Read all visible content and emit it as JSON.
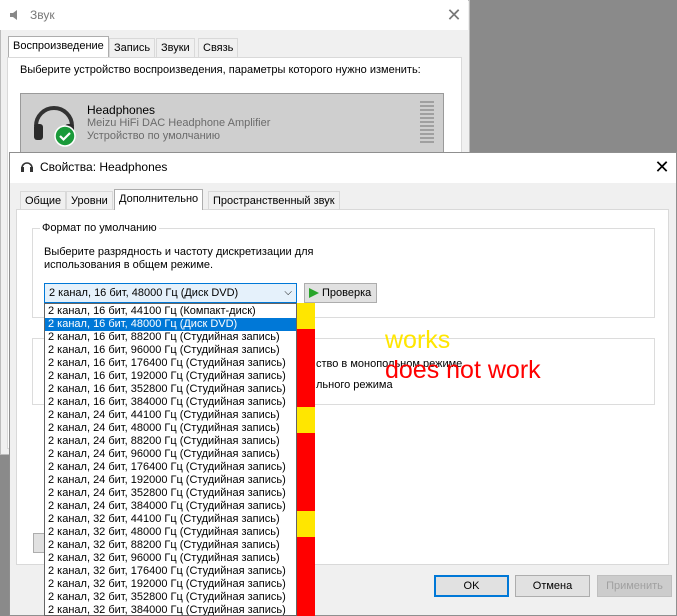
{
  "sound_window": {
    "title": "Звук",
    "tabs": [
      "Воспроизведение",
      "Запись",
      "Звуки",
      "Связь"
    ],
    "active_tab": 0,
    "description": "Выберите устройство воспроизведения, параметры которого нужно изменить:",
    "device": {
      "name": "Headphones",
      "description": "Meizu HiFi DAC Headphone Amplifier",
      "status": "Устройство по умолчанию"
    }
  },
  "props_window": {
    "title": "Свойства: Headphones",
    "tabs": [
      "Общие",
      "Уровни",
      "Дополнительно",
      "Пространственный звук"
    ],
    "active_tab": 2,
    "default_format": {
      "legend": "Формат по умолчанию",
      "description": "Выберите разрядность и частоту дискретизации для использования в общем режиме.",
      "selected": "2 канал, 16 бит, 48000 Гц (Диск DVD)",
      "test_label": "Проверка"
    },
    "exclusive_fragments": {
      "line1": "ство в монопольном режиме",
      "line2": "льного режима"
    },
    "buttons": {
      "ok": "OK",
      "cancel": "Отмена",
      "apply": "Применить"
    }
  },
  "dropdown": {
    "selected_index": 1,
    "options": [
      "2 канал, 16 бит, 44100 Гц (Компакт-диск)",
      "2 канал, 16 бит, 48000 Гц (Диск DVD)",
      "2 канал, 16 бит, 88200 Гц (Студийная запись)",
      "2 канал, 16 бит, 96000 Гц (Студийная запись)",
      "2 канал, 16 бит, 176400 Гц (Студийная запись)",
      "2 канал, 16 бит, 192000 Гц (Студийная запись)",
      "2 канал, 16 бит, 352800 Гц (Студийная запись)",
      "2 канал, 16 бит, 384000 Гц (Студийная запись)",
      "2 канал, 24 бит, 44100 Гц (Студийная запись)",
      "2 канал, 24 бит, 48000 Гц (Студийная запись)",
      "2 канал, 24 бит, 88200 Гц (Студийная запись)",
      "2 канал, 24 бит, 96000 Гц (Студийная запись)",
      "2 канал, 24 бит, 176400 Гц (Студийная запись)",
      "2 канал, 24 бит, 192000 Гц (Студийная запись)",
      "2 канал, 24 бит, 352800 Гц (Студийная запись)",
      "2 канал, 24 бит, 384000 Гц (Студийная запись)",
      "2 канал, 32 бит, 44100 Гц (Студийная запись)",
      "2 канал, 32 бит, 48000 Гц (Студийная запись)",
      "2 канал, 32 бит, 88200 Гц (Студийная запись)",
      "2 канал, 32 бит, 96000 Гц (Студийная запись)",
      "2 канал, 32 бит, 176400 Гц (Студийная запись)",
      "2 канал, 32 бит, 192000 Гц (Студийная запись)",
      "2 канал, 32 бит, 352800 Гц (Студийная запись)",
      "2 канал, 32 бит, 384000 Гц (Студийная запись)"
    ],
    "works": [
      true,
      true,
      false,
      false,
      false,
      false,
      false,
      false,
      true,
      true,
      false,
      false,
      false,
      false,
      false,
      false,
      true,
      true,
      false,
      false,
      false,
      false,
      false,
      false
    ]
  },
  "annotations": {
    "works": "works",
    "not_work": "does not work"
  },
  "colors": {
    "works": "#ffe600",
    "not_work": "#ff0000",
    "selection": "#0078d7"
  },
  "icons": [
    "speaker-icon",
    "headphones-icon",
    "check-icon",
    "close-icon",
    "play-icon",
    "chevron-down-icon"
  ]
}
